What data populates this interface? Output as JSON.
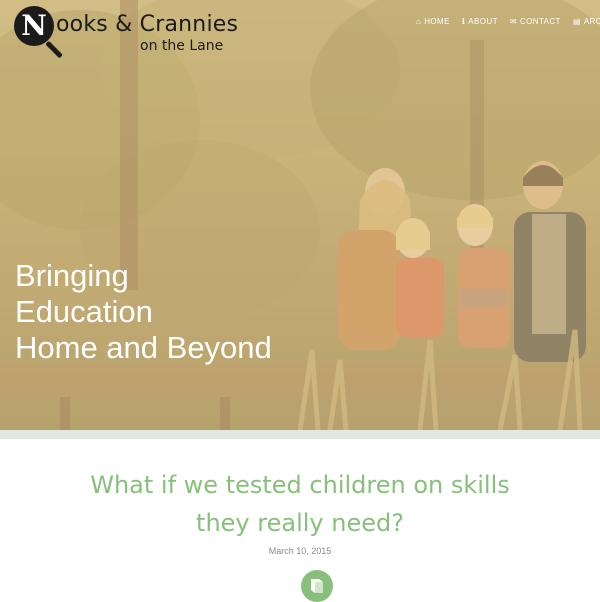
{
  "site": {
    "logo_letter": "N",
    "logo_title": "ooks & Crannies",
    "logo_subtitle": "on the Lane"
  },
  "nav": {
    "items": [
      {
        "label": "HOME",
        "icon": "home-icon"
      },
      {
        "label": "ABOUT",
        "icon": "info-icon"
      },
      {
        "label": "CONTACT",
        "icon": "mail-icon"
      },
      {
        "label": "ARCH",
        "icon": "archive-icon"
      }
    ]
  },
  "hero": {
    "lines": [
      "Bringing",
      "Education",
      "Home and Beyond"
    ]
  },
  "post": {
    "title_lines": [
      "What if we tested children on skills",
      "they really need?"
    ],
    "date": "March 10, 2015",
    "badge_icon": "book-icon"
  },
  "colors": {
    "accent_green": "#88bf7c",
    "divider": "#e1e7e1",
    "logo_dark": "#1b1b1b"
  }
}
